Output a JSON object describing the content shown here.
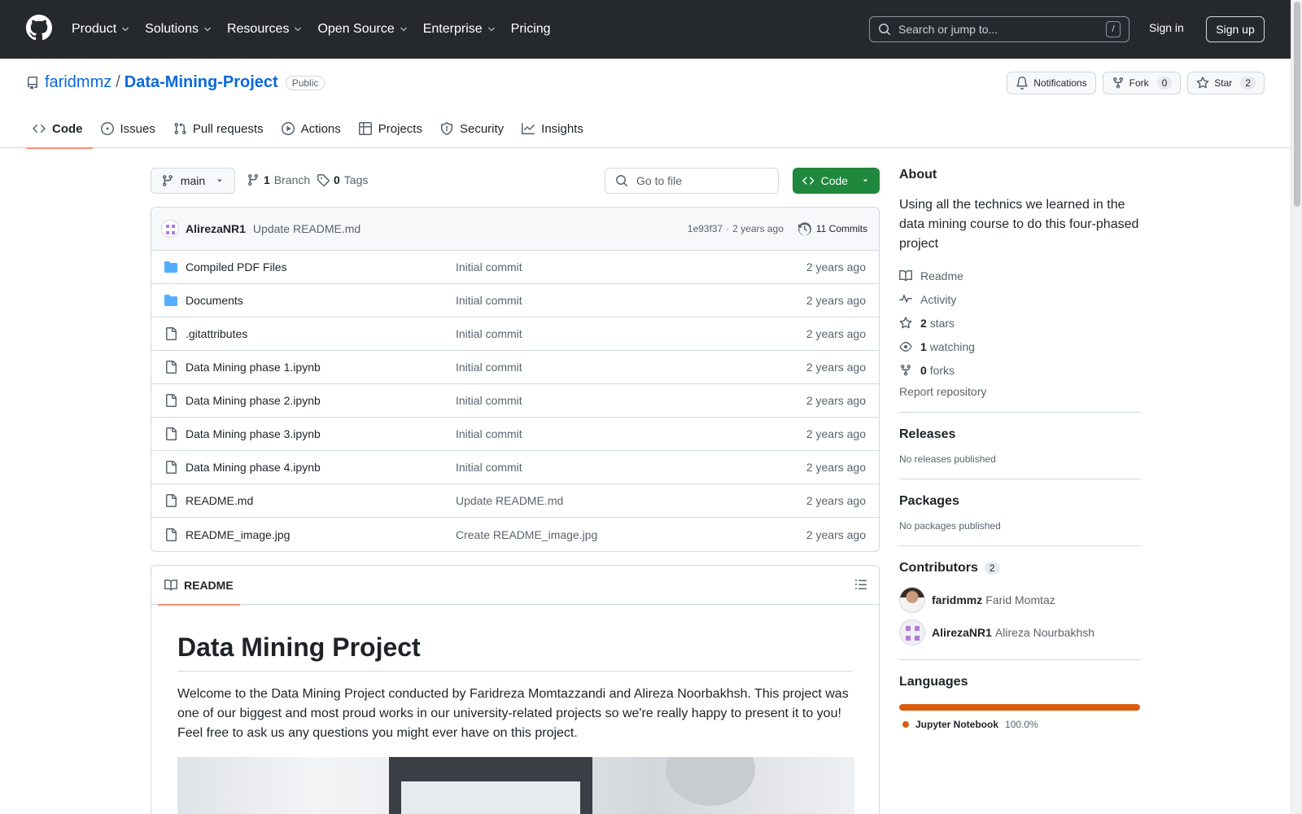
{
  "header": {
    "nav": [
      {
        "label": "Product",
        "dropdown": true
      },
      {
        "label": "Solutions",
        "dropdown": true
      },
      {
        "label": "Resources",
        "dropdown": true
      },
      {
        "label": "Open Source",
        "dropdown": true
      },
      {
        "label": "Enterprise",
        "dropdown": true
      },
      {
        "label": "Pricing",
        "dropdown": false
      }
    ],
    "search_placeholder": "Search or jump to...",
    "search_shortcut": "/",
    "sign_in": "Sign in",
    "sign_up": "Sign up"
  },
  "repo": {
    "owner": "faridmmz",
    "separator": "/",
    "name": "Data-Mining-Project",
    "visibility": "Public",
    "notifications_label": "Notifications",
    "fork_label": "Fork",
    "fork_count": "0",
    "star_label": "Star",
    "star_count": "2",
    "tabs": [
      {
        "label": "Code",
        "icon": "code-icon",
        "active": true
      },
      {
        "label": "Issues",
        "icon": "issue-icon",
        "active": false
      },
      {
        "label": "Pull requests",
        "icon": "pull-request-icon",
        "active": false
      },
      {
        "label": "Actions",
        "icon": "play-icon",
        "active": false
      },
      {
        "label": "Projects",
        "icon": "table-icon",
        "active": false
      },
      {
        "label": "Security",
        "icon": "shield-icon",
        "active": false
      },
      {
        "label": "Insights",
        "icon": "graph-icon",
        "active": false
      }
    ]
  },
  "branchbar": {
    "branch": "main",
    "branch_count": "1",
    "branch_label": "Branch",
    "tag_count": "0",
    "tag_label": "Tags",
    "goto_placeholder": "Go to file",
    "code_button": "Code"
  },
  "commit": {
    "author": "AlirezaNR1",
    "message": "Update README.md",
    "hash": "1e93f37",
    "dot": "·",
    "time": "2 years ago",
    "commits_label": "11 Commits"
  },
  "files": [
    {
      "type": "dir",
      "name": "Compiled PDF Files",
      "message": "Initial commit",
      "date": "2 years ago"
    },
    {
      "type": "dir",
      "name": "Documents",
      "message": "Initial commit",
      "date": "2 years ago"
    },
    {
      "type": "file",
      "name": ".gitattributes",
      "message": "Initial commit",
      "date": "2 years ago"
    },
    {
      "type": "file",
      "name": "Data Mining phase 1.ipynb",
      "message": "Initial commit",
      "date": "2 years ago"
    },
    {
      "type": "file",
      "name": "Data Mining phase 2.ipynb",
      "message": "Initial commit",
      "date": "2 years ago"
    },
    {
      "type": "file",
      "name": "Data Mining phase 3.ipynb",
      "message": "Initial commit",
      "date": "2 years ago"
    },
    {
      "type": "file",
      "name": "Data Mining phase 4.ipynb",
      "message": "Initial commit",
      "date": "2 years ago"
    },
    {
      "type": "file",
      "name": "README.md",
      "message": "Update README.md",
      "date": "2 years ago"
    },
    {
      "type": "file",
      "name": "README_image.jpg",
      "message": "Create README_image.jpg",
      "date": "2 years ago"
    }
  ],
  "readme": {
    "tab_label": "README",
    "title": "Data Mining Project",
    "paragraph": "Welcome to the Data Mining Project conducted by Faridreza Momtazzandi and Alireza Noorbakhsh. This project was one of our biggest and most proud works in our university-related projects so we're really happy to present it to you! Feel free to ask us any questions you might ever have on this project."
  },
  "sidebar": {
    "about_title": "About",
    "description": "Using all the technics we learned in the data mining course to do this four-phased project",
    "readme_label": "Readme",
    "activity_label": "Activity",
    "stars_count": "2",
    "stars_label": "stars",
    "watching_count": "1",
    "watching_label": "watching",
    "forks_count": "0",
    "forks_label": "forks",
    "report_label": "Report repository",
    "releases_title": "Releases",
    "releases_text": "No releases published",
    "packages_title": "Packages",
    "packages_text": "No packages published",
    "contributors_title": "Contributors",
    "contributors_count": "2",
    "contributors": [
      {
        "login": "faridmmz",
        "name": "Farid Momtaz"
      },
      {
        "login": "AlirezaNR1",
        "name": "Alireza Nourbakhsh"
      }
    ],
    "languages_title": "Languages",
    "language": {
      "name": "Jupyter Notebook",
      "percent": "100.0%",
      "share": 1.0,
      "color": "#da5b0b"
    }
  },
  "colors": {
    "header_bg": "#25292e",
    "link": "#0969da",
    "code_button": "#1f883d",
    "active_tab": "#fd8c73",
    "folder": "#54aeff"
  }
}
